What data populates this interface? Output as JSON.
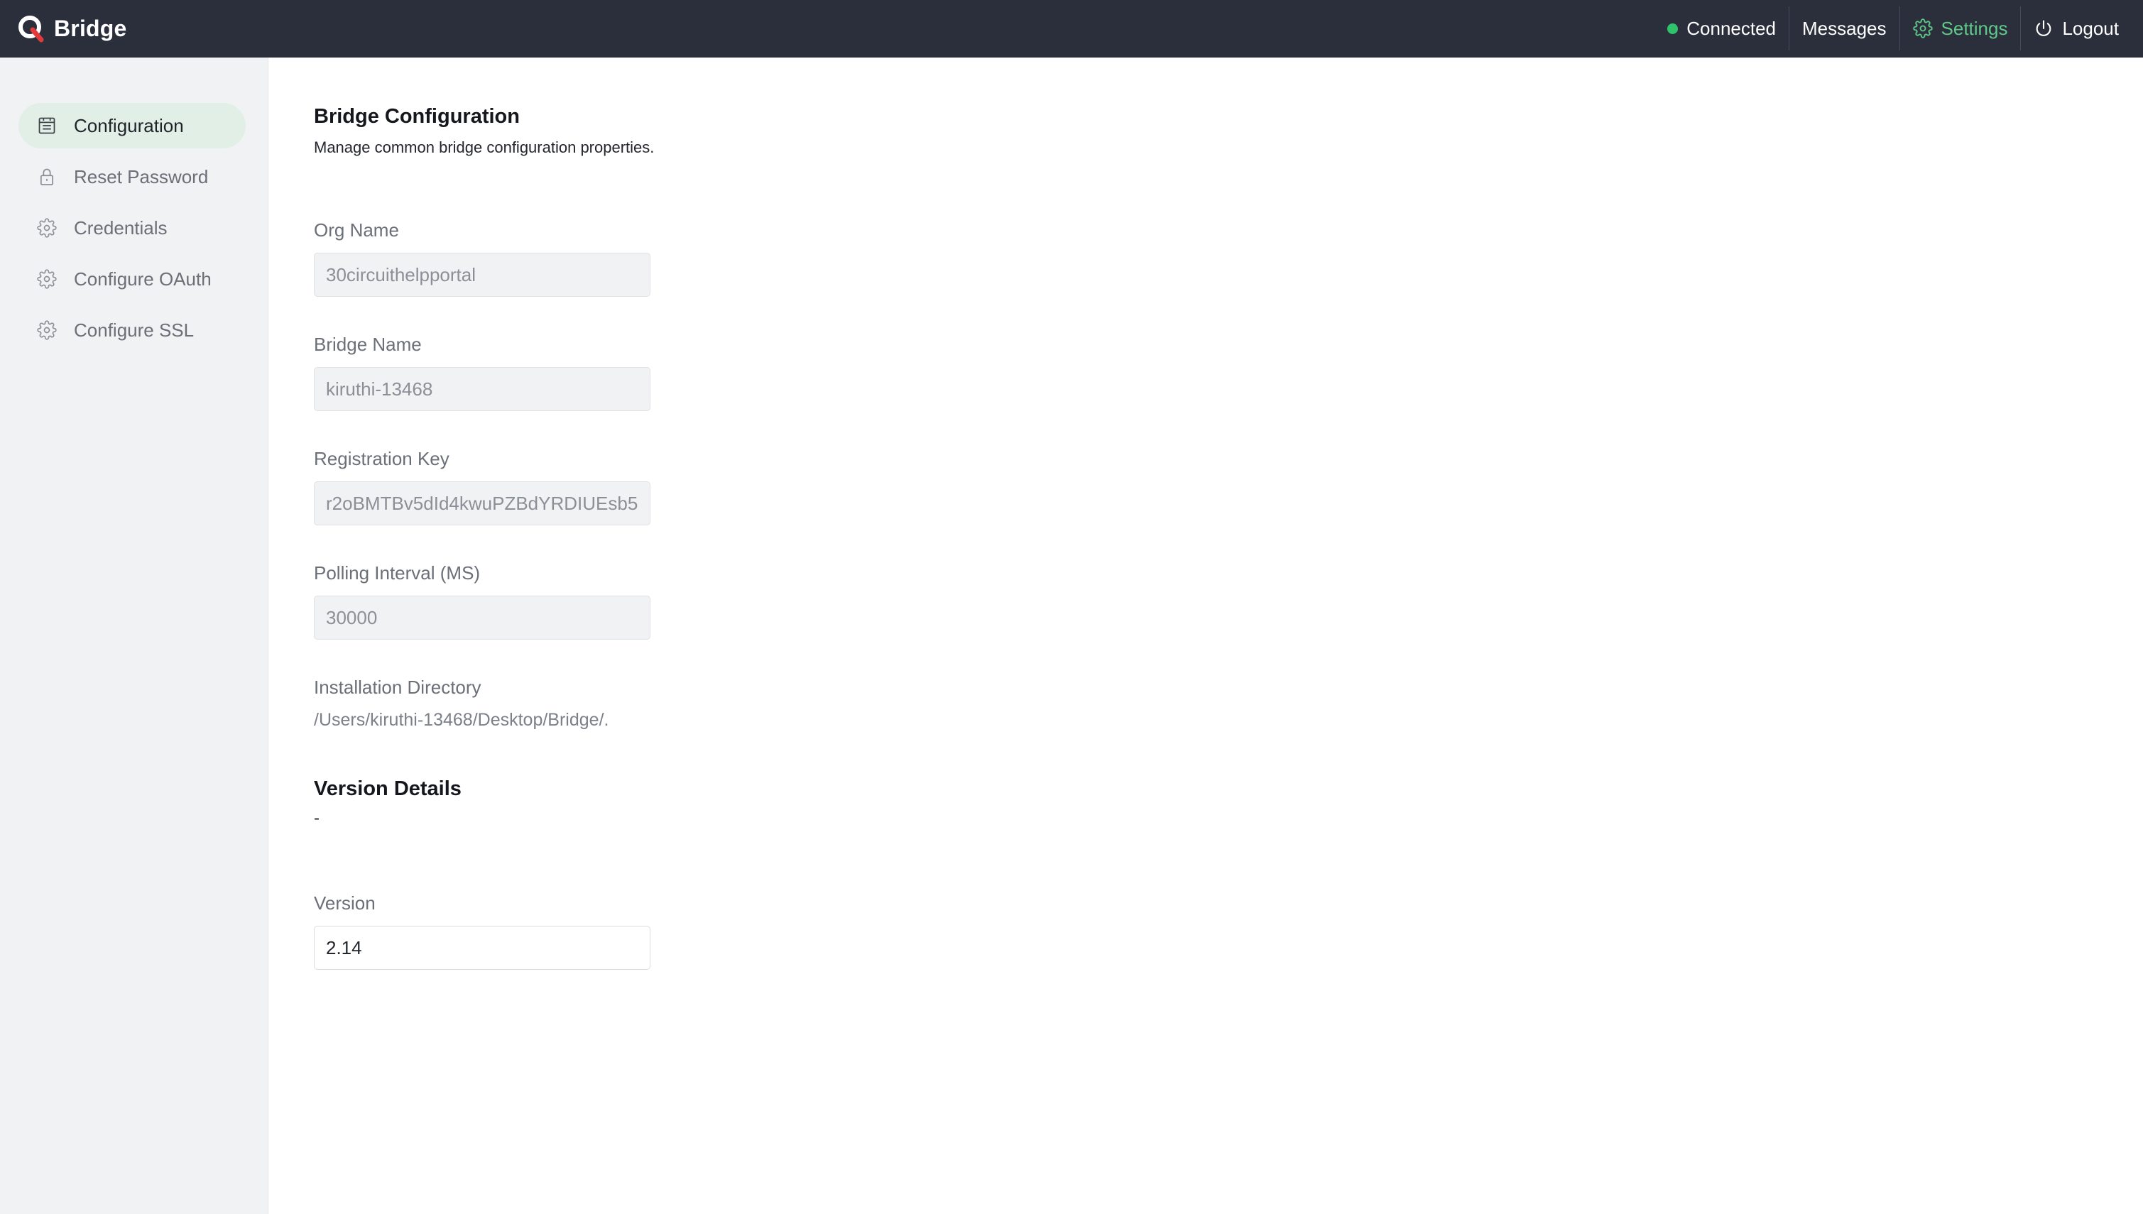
{
  "app": {
    "name": "Bridge"
  },
  "topnav": {
    "status_label": "Connected",
    "status_color": "#2fc46b",
    "messages_label": "Messages",
    "settings_label": "Settings",
    "settings_color": "#5fc98a",
    "logout_label": "Logout"
  },
  "sidebar": {
    "items": [
      {
        "label": "Configuration",
        "icon": "calendar-icon",
        "active": true
      },
      {
        "label": "Reset Password",
        "icon": "lock-icon",
        "active": false
      },
      {
        "label": "Credentials",
        "icon": "gear-icon",
        "active": false
      },
      {
        "label": "Configure OAuth",
        "icon": "gear-icon",
        "active": false
      },
      {
        "label": "Configure SSL",
        "icon": "gear-icon",
        "active": false
      }
    ]
  },
  "main": {
    "title": "Bridge Configuration",
    "subtitle": "Manage common bridge configuration properties.",
    "org_name": {
      "label": "Org Name",
      "value": "30circuithelpportal"
    },
    "bridge_name": {
      "label": "Bridge Name",
      "value": "kiruthi-13468"
    },
    "registration_key": {
      "label": "Registration Key",
      "value": "r2oBMTBv5dId4kwuPZBdYRDIUEsb5"
    },
    "polling_interval": {
      "label": "Polling Interval (MS)",
      "value": "30000"
    },
    "installation_directory": {
      "label": "Installation Directory",
      "value": "/Users/kiruthi-13468/Desktop/Bridge/."
    },
    "version_details": {
      "title": "Version Details",
      "placeholder": "-"
    },
    "version": {
      "label": "Version",
      "value": "2.14"
    }
  }
}
